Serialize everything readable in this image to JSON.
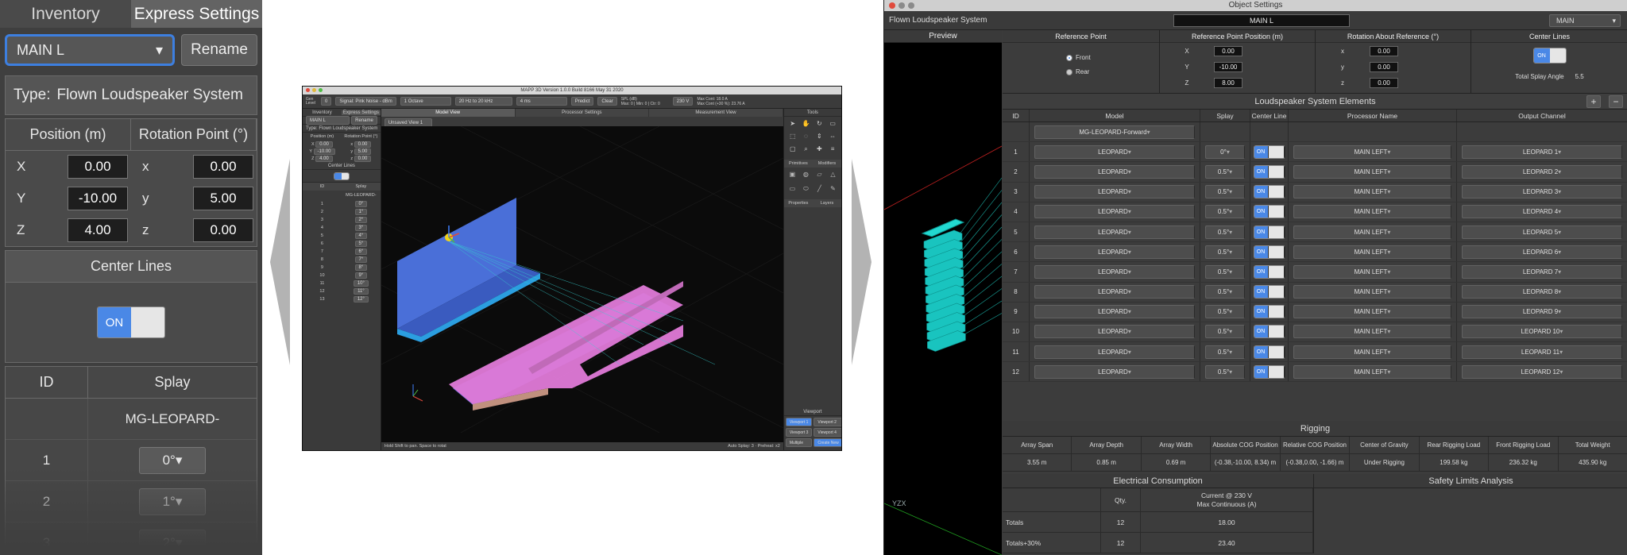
{
  "left_zoom": {
    "tabs": [
      "Inventory",
      "Express Settings"
    ],
    "name_dropdown": "MAIN L",
    "rename_button": "Rename",
    "type_label": "Type:",
    "type_value": "Flown Loudspeaker System",
    "position_header": "Position (m)",
    "rotation_header": "Rotation Point (°)",
    "pos": [
      {
        "axis": "X",
        "value": "0.00"
      },
      {
        "axis": "Y",
        "value": "-10.00"
      },
      {
        "axis": "Z",
        "value": "4.00"
      }
    ],
    "rot": [
      {
        "axis": "x",
        "value": "0.00"
      },
      {
        "axis": "y",
        "value": "5.00"
      },
      {
        "axis": "z",
        "value": "0.00"
      }
    ],
    "center_lines": "Center Lines",
    "toggle_on": "ON",
    "table_id_header": "ID",
    "table_splay_header": "Splay",
    "model_row": "MG-LEOPARD-",
    "rows": [
      {
        "id": "1",
        "splay": "0°"
      },
      {
        "id": "2",
        "splay": "1°"
      },
      {
        "id": "3",
        "splay": "2°"
      }
    ]
  },
  "mapp": {
    "title": "MAPP 3D Version 1.0.0 Build 8166 May 31 2020",
    "toolbar": {
      "gen": "Gen Level",
      "gen_value": "0",
      "signal": "Signal: Pink Noise - dBm",
      "octave": "1 Octave",
      "range": "20 Hz to 20 kHz",
      "ms": "4 ms",
      "predict": "Predict",
      "clear": "Clear",
      "spl": "SPL (dB)",
      "max": "Max: 0 | Min: 0 | Ctr: 0",
      "volt": "230 V",
      "maxcont": "Max Cont: 18.0 A",
      "maxcont2": "Max Cont (+30 %): 23.76 A"
    },
    "left_tabs": [
      "Inventory",
      "Express Settings"
    ],
    "main_l": "MAIN L",
    "rename": "Rename",
    "type": "Type:  Flown Loudspeaker System",
    "position": "Position (m)",
    "rotation": "Rotation Point (°)",
    "pos": [
      {
        "a": "X",
        "v": "0.00",
        "b": "x",
        "w": "0.00"
      },
      {
        "a": "Y",
        "v": "-10.00",
        "b": "y",
        "w": "5.00"
      },
      {
        "a": "Z",
        "v": "4.00",
        "b": "z",
        "w": "0.00"
      }
    ],
    "center_lines": "Center Lines",
    "id": "ID",
    "splay": "Splay",
    "model": "MG-LEOPARD-",
    "splays": [
      "0°",
      "1°",
      "2°",
      "3°",
      "4°",
      "5°",
      "6°",
      "7°",
      "8°",
      "9°",
      "10°",
      "11°",
      "12°"
    ],
    "main_tabs": [
      "Model View",
      "Processor Settings",
      "Measurement View"
    ],
    "view_dropdown": "Unsaved View 1",
    "tools_header": "Tools",
    "prim_tabs": [
      "Primitives",
      "Modifiers"
    ],
    "prop_tabs": [
      "Properties",
      "Layers"
    ],
    "viewport": "Viewport",
    "vp_buttons": [
      "Viewport 1",
      "Viewport 2",
      "Viewport 3",
      "Viewport 4",
      "Multiple",
      "Create New"
    ],
    "status_left": "Hold Shift to pan. Space to rotat",
    "status_right": "Auto Splay: 3 · Preheat: x2"
  },
  "object_settings": {
    "window_title": "Object Settings",
    "object_type": "Flown Loudspeaker System",
    "name": "MAIN L",
    "group": "MAIN",
    "preview": "Preview",
    "ref_point": "Reference Point",
    "ref_front": "Front",
    "ref_rear": "Rear",
    "ref_pos": "Reference Point Position (m)",
    "ref_pos_vals": [
      {
        "a": "X",
        "v": "0.00"
      },
      {
        "a": "Y",
        "v": "-10.00"
      },
      {
        "a": "Z",
        "v": "8.00"
      }
    ],
    "rotation": "Rotation About Reference (°)",
    "rot_vals": [
      {
        "a": "x",
        "v": "0.00"
      },
      {
        "a": "y",
        "v": "0.00"
      },
      {
        "a": "z",
        "v": "0.00"
      }
    ],
    "center_lines": "Center Lines",
    "on": "ON",
    "total_splay_label": "Total Splay Angle",
    "total_splay_value": "5.5",
    "elements_title": "Loudspeaker System Elements",
    "plus": "+",
    "minus": "−",
    "columns": [
      "ID",
      "Model",
      "Splay",
      "Center Line",
      "Processor Name",
      "Output Channel"
    ],
    "rigging_frame": "MG-LEOPARD-Forward",
    "elements": [
      {
        "id": "1",
        "model": "LEOPARD",
        "splay": "0°",
        "proc": "MAIN LEFT",
        "out": "LEOPARD 1"
      },
      {
        "id": "2",
        "model": "LEOPARD",
        "splay": "0.5°",
        "proc": "MAIN LEFT",
        "out": "LEOPARD 2"
      },
      {
        "id": "3",
        "model": "LEOPARD",
        "splay": "0.5°",
        "proc": "MAIN LEFT",
        "out": "LEOPARD 3"
      },
      {
        "id": "4",
        "model": "LEOPARD",
        "splay": "0.5°",
        "proc": "MAIN LEFT",
        "out": "LEOPARD 4"
      },
      {
        "id": "5",
        "model": "LEOPARD",
        "splay": "0.5°",
        "proc": "MAIN LEFT",
        "out": "LEOPARD 5"
      },
      {
        "id": "6",
        "model": "LEOPARD",
        "splay": "0.5°",
        "proc": "MAIN LEFT",
        "out": "LEOPARD 6"
      },
      {
        "id": "7",
        "model": "LEOPARD",
        "splay": "0.5°",
        "proc": "MAIN LEFT",
        "out": "LEOPARD 7"
      },
      {
        "id": "8",
        "model": "LEOPARD",
        "splay": "0.5°",
        "proc": "MAIN LEFT",
        "out": "LEOPARD 8"
      },
      {
        "id": "9",
        "model": "LEOPARD",
        "splay": "0.5°",
        "proc": "MAIN LEFT",
        "out": "LEOPARD 9"
      },
      {
        "id": "10",
        "model": "LEOPARD",
        "splay": "0.5°",
        "proc": "MAIN LEFT",
        "out": "LEOPARD 10"
      },
      {
        "id": "11",
        "model": "LEOPARD",
        "splay": "0.5°",
        "proc": "MAIN LEFT",
        "out": "LEOPARD 11"
      },
      {
        "id": "12",
        "model": "LEOPARD",
        "splay": "0.5°",
        "proc": "MAIN LEFT",
        "out": "LEOPARD 12"
      }
    ],
    "rigging_title": "Rigging",
    "rigging_cols": [
      "Array Span",
      "Array Depth",
      "Array Width",
      "Absolute COG Position",
      "Relative COG Position",
      "Center of Gravity",
      "Rear Rigging Load",
      "Front Rigging Load",
      "Total Weight"
    ],
    "rigging_vals": [
      "3.55 m",
      "0.85 m",
      "0.69 m",
      "(-0.38,-10.00, 8.34) m",
      "(-0.38,0.00, -1.66) m",
      "Under Rigging",
      "199.58 kg",
      "236.32 kg",
      "435.90 kg"
    ],
    "elec_title": "Electrical Consumption",
    "safety_title": "Safety Limits Analysis",
    "elec_qty": "Qty.",
    "elec_current": "Current @ 230 V",
    "elec_current2": "Max Continuous (A)",
    "elec_rows": [
      {
        "label": "Totals",
        "qty": "12",
        "val": "18.00"
      },
      {
        "label": "Totals+30%",
        "qty": "12",
        "val": "23.40"
      }
    ],
    "axis_label": "YZX"
  },
  "colors": {
    "accent": "#4a88e6",
    "speaker": "#19c4bf",
    "pink": "#e07ad8",
    "blue_wall": "#4a6fd8"
  }
}
